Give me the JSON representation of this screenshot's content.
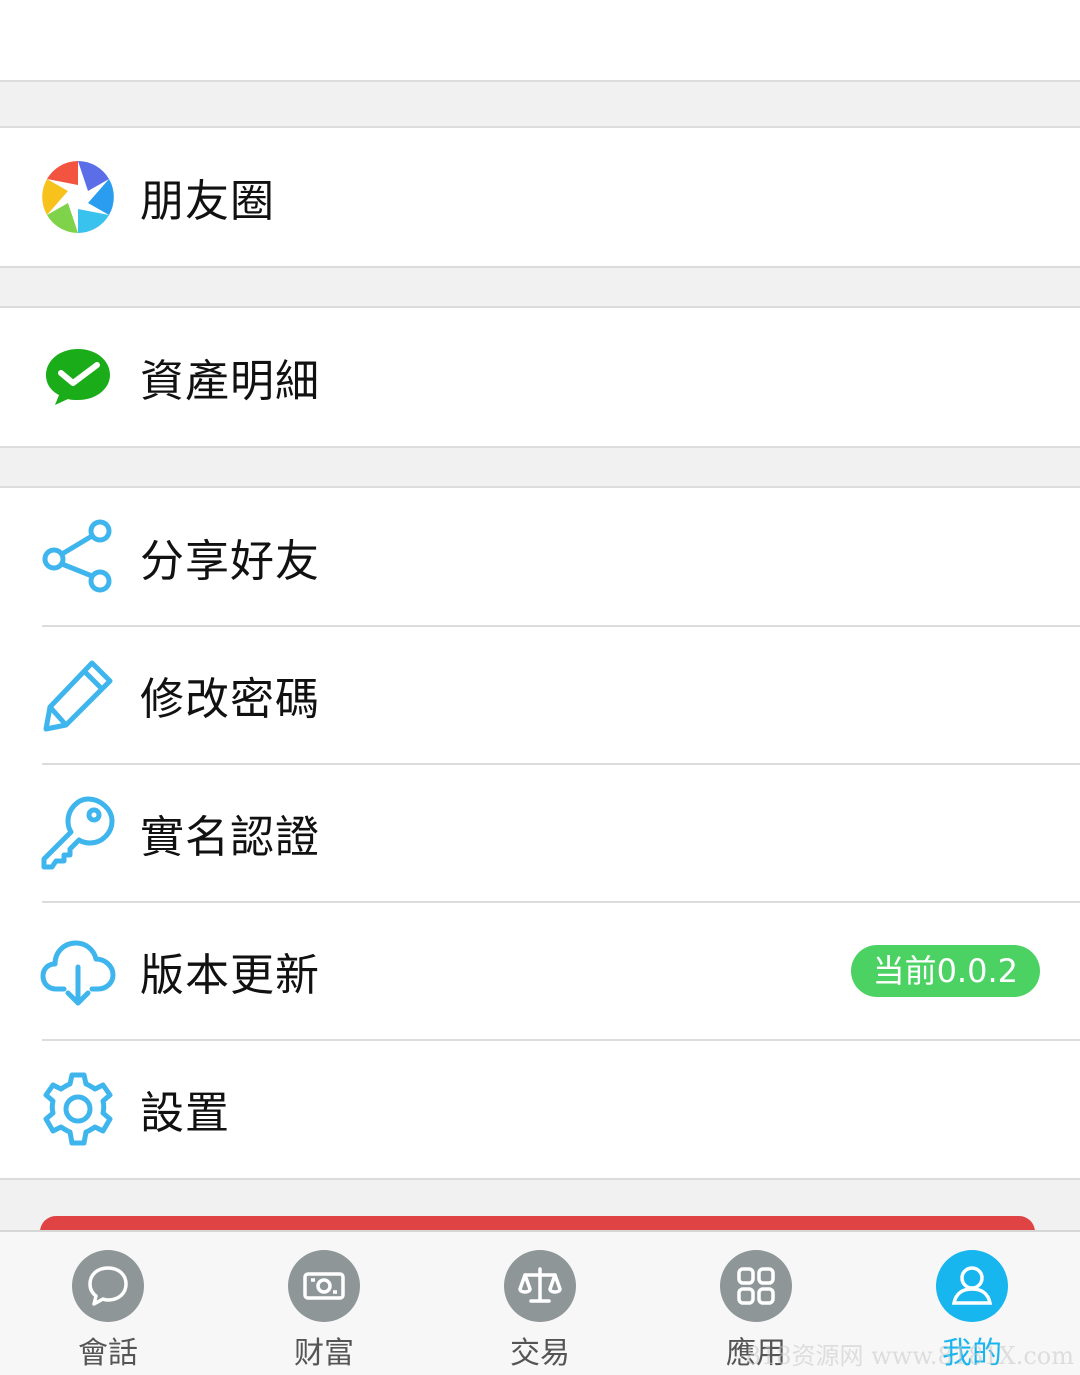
{
  "menu": {
    "moments": {
      "label": "朋友圈",
      "icon": "aperture-icon"
    },
    "assets": {
      "label": "資產明細",
      "icon": "wechat-pay-icon"
    },
    "share": {
      "label": "分享好友",
      "icon": "share-icon"
    },
    "password": {
      "label": "修改密碼",
      "icon": "pencil-icon"
    },
    "verify": {
      "label": "實名認證",
      "icon": "key-icon"
    },
    "update": {
      "label": "版本更新",
      "icon": "cloud-download-icon",
      "badge": "当前0.0.2"
    },
    "settings": {
      "label": "設置",
      "icon": "gear-icon"
    }
  },
  "tabbar": {
    "tabs": [
      {
        "label": "會話",
        "icon": "chat-bubble-icon"
      },
      {
        "label": "财富",
        "icon": "cash-icon"
      },
      {
        "label": "交易",
        "icon": "scale-icon"
      },
      {
        "label": "應用",
        "icon": "apps-grid-icon"
      },
      {
        "label": "我的",
        "icon": "user-icon",
        "active": true
      }
    ]
  },
  "watermark": "818资源网 www.8181X.com",
  "colors": {
    "accent": "#17b6ef",
    "badge": "#4cd263",
    "logout": "#e04343",
    "icon_blue": "#3fb5ee"
  }
}
